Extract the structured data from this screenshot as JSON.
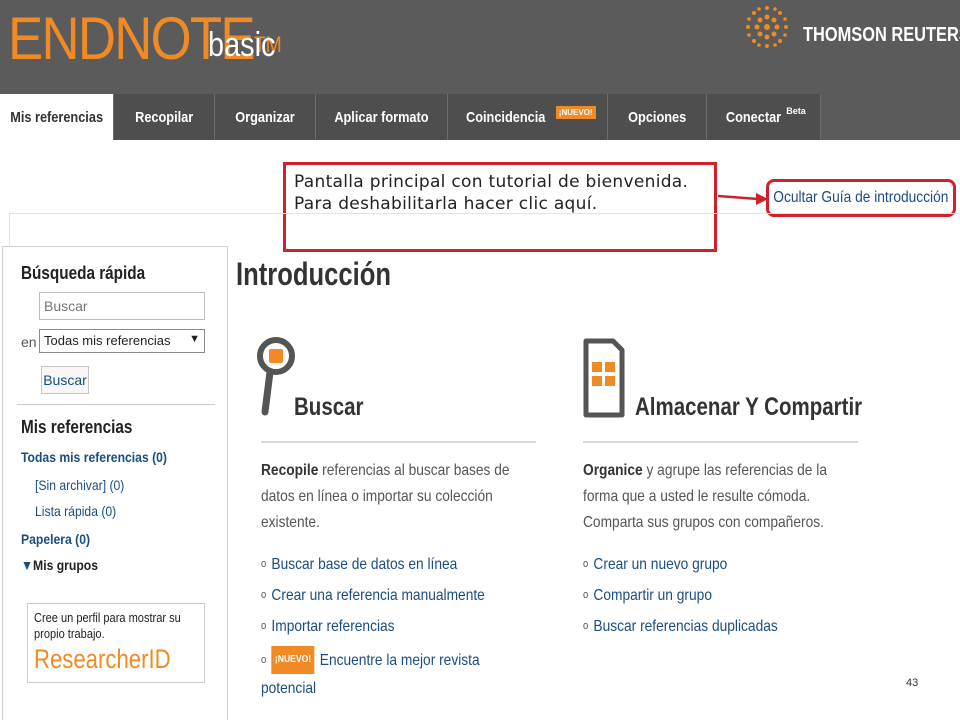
{
  "header": {
    "logo_main": "ENDNOTE",
    "logo_tm": "TM",
    "logo_sub": "basic",
    "partner": "THOMSON REUTERS",
    "partner_tm": "®"
  },
  "nav": {
    "tabs": [
      {
        "label": "Mis referencias",
        "active": true
      },
      {
        "label": "Recopilar"
      },
      {
        "label": "Organizar"
      },
      {
        "label": "Aplicar formato"
      },
      {
        "label": "Coincidencia",
        "badge": "¡NUEVO!"
      },
      {
        "label": "Opciones"
      },
      {
        "label": "Conectar",
        "sup": "Beta"
      }
    ]
  },
  "callout": {
    "text": "Pantalla principal con tutorial  de bienvenida. Para deshabilitarla hacer clic aquí."
  },
  "hide_guide_link": "Ocultar Guía de introducción",
  "sidebar": {
    "quick_search_title": "Búsqueda rápida",
    "search_placeholder": "Buscar",
    "in_label": "en",
    "scope_selected": "Todas mis referencias",
    "search_button": "Buscar",
    "refs_title": "Mis referencias",
    "all_refs": "Todas mis referencias (0)",
    "unfiled": "[Sin archivar] (0)",
    "quick_list": "Lista rápida (0)",
    "trash": "Papelera (0)",
    "my_groups": "Mis grupos",
    "researcherid_text": "Cree un perfil para mostrar su propio trabajo.",
    "researcherid_logo": "ResearcherID"
  },
  "main": {
    "title": "Introducción",
    "search_section": {
      "title": "Buscar",
      "desc_bold": "Recopile",
      "desc_rest": " referencias al buscar bases de datos en línea o importar su colección existente.",
      "links": [
        "Buscar base de datos en línea",
        "Crear una referencia manualmente",
        "Importar referencias"
      ],
      "new_badge": "¡NUEVO!",
      "new_link": "Encuentre la mejor revista",
      "new_link_cont": "potencial"
    },
    "store_section": {
      "title": "Almacenar Y Compartir",
      "desc_bold": "Organice",
      "desc_rest": " y agrupe las referencias de la forma que a usted le resulte cómoda. Comparta sus grupos con compañeros.",
      "links": [
        "Crear un nuevo grupo",
        "Compartir un grupo",
        "Buscar referencias duplicadas"
      ]
    }
  },
  "page_number": "43",
  "colors": {
    "accent": "#f08a24",
    "header_bg": "#5b5b5b",
    "link": "#1a4d80",
    "callout_border": "#d0202a"
  }
}
